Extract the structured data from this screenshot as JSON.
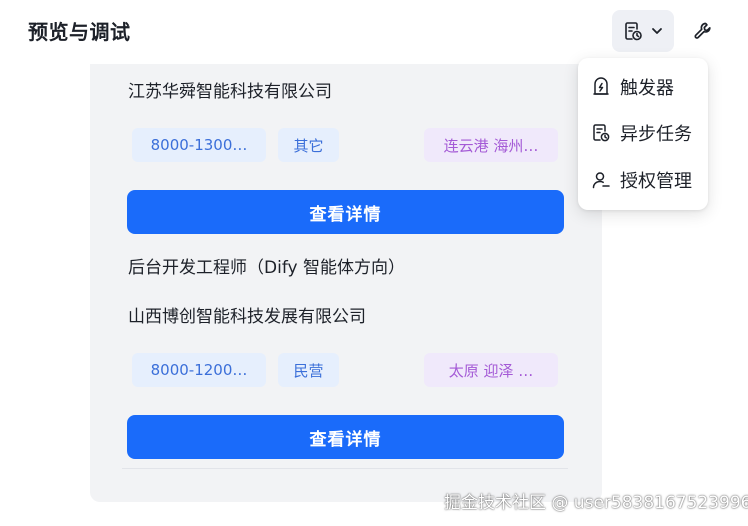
{
  "header": {
    "title": "预览与调试"
  },
  "toolbar": {
    "doc_icon": "document-clock-icon",
    "chevron_icon": "chevron-down-icon",
    "wrench_icon": "wrench-icon"
  },
  "dropdown": {
    "items": [
      {
        "label": "触发器",
        "icon": "trigger-icon"
      },
      {
        "label": "异步任务",
        "icon": "async-task-icon"
      },
      {
        "label": "授权管理",
        "icon": "user-auth-icon"
      }
    ]
  },
  "jobs": [
    {
      "company": "江苏华舜智能科技有限公司",
      "salary": "8000-1300…",
      "type": "其它",
      "location": "连云港 海州…",
      "button": "查看详情"
    },
    {
      "title": "后台开发工程师（Dify 智能体方向）",
      "company": "山西博创智能科技发展有限公司",
      "salary": "8000-1200…",
      "type": "民营",
      "location": "太原 迎泽 …",
      "button": "查看详情"
    }
  ],
  "watermark": "掘金技术社区 @ user5838167523996",
  "colors": {
    "primary": "#1a6bfa",
    "tag_blue_bg": "#e6effd",
    "tag_blue_text": "#3b6fd9",
    "tag_purple_bg": "#f0e9fb",
    "tag_purple_text": "#a45ad6",
    "panel_bg": "#f2f3f5"
  }
}
